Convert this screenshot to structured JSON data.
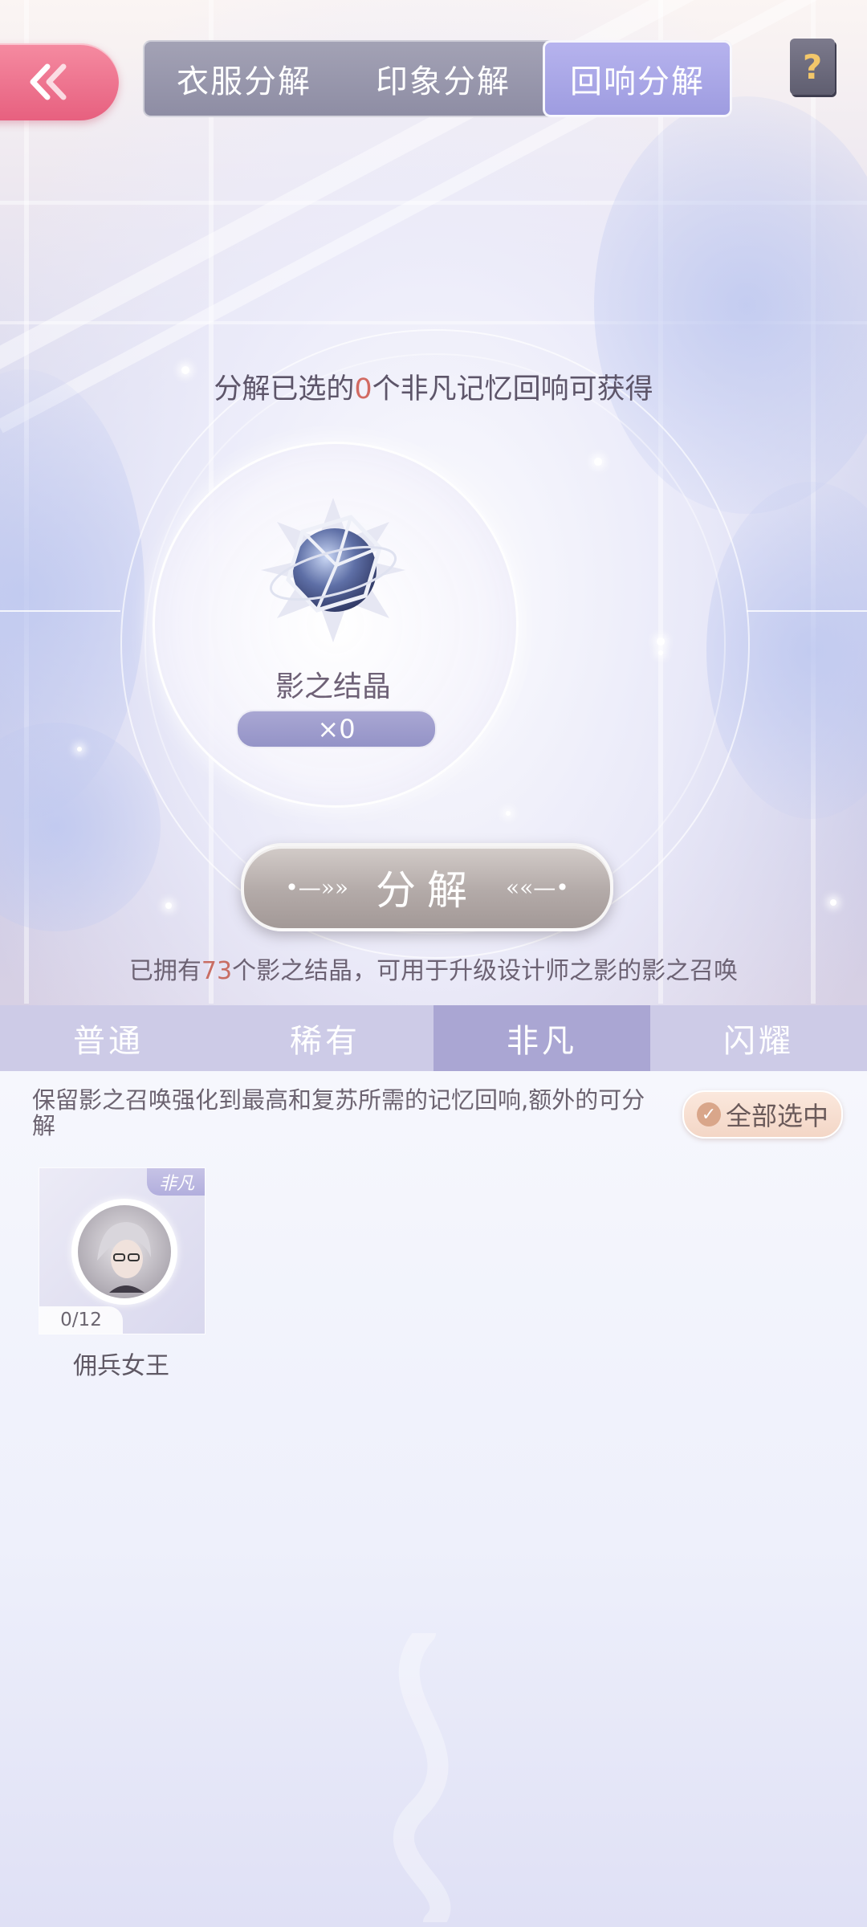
{
  "top_tabs": [
    {
      "label": "衣服分解",
      "active": false
    },
    {
      "label": "印象分解",
      "active": false
    },
    {
      "label": "回响分解",
      "active": true
    }
  ],
  "help_icon": "question-book-icon",
  "back_icon": "double-chevron-left-icon",
  "prompt": {
    "prefix": "分解已选的",
    "count": "0",
    "suffix": "个非凡记忆回响可获得"
  },
  "reward": {
    "name": "影之结晶",
    "count": "×0",
    "icon": "shadow-crystal-icon"
  },
  "decompose_button": {
    "label": "分解"
  },
  "owned": {
    "prefix": "已拥有",
    "count": "73",
    "suffix": "个影之结晶，可用于升级设计师之影的影之召唤"
  },
  "rarity_tabs": [
    {
      "label": "普通",
      "active": false
    },
    {
      "label": "稀有",
      "active": false
    },
    {
      "label": "非凡",
      "active": true
    },
    {
      "label": "闪耀",
      "active": false
    }
  ],
  "description": "保留影之召唤强化到最高和复苏所需的记忆回响,额外的可分解",
  "select_all": {
    "label": "全部选中",
    "icon": "check-circle-icon"
  },
  "items": [
    {
      "name": "佣兵女王",
      "tag": "非凡",
      "progress": "0/12",
      "icon": "character-portrait-icon"
    }
  ],
  "colors": {
    "accent_pink": "#e7607f",
    "active_tab": "#9e9ce0",
    "highlight_number": "#d26a62",
    "rarity_tab_bar": "#cdcbe7"
  }
}
